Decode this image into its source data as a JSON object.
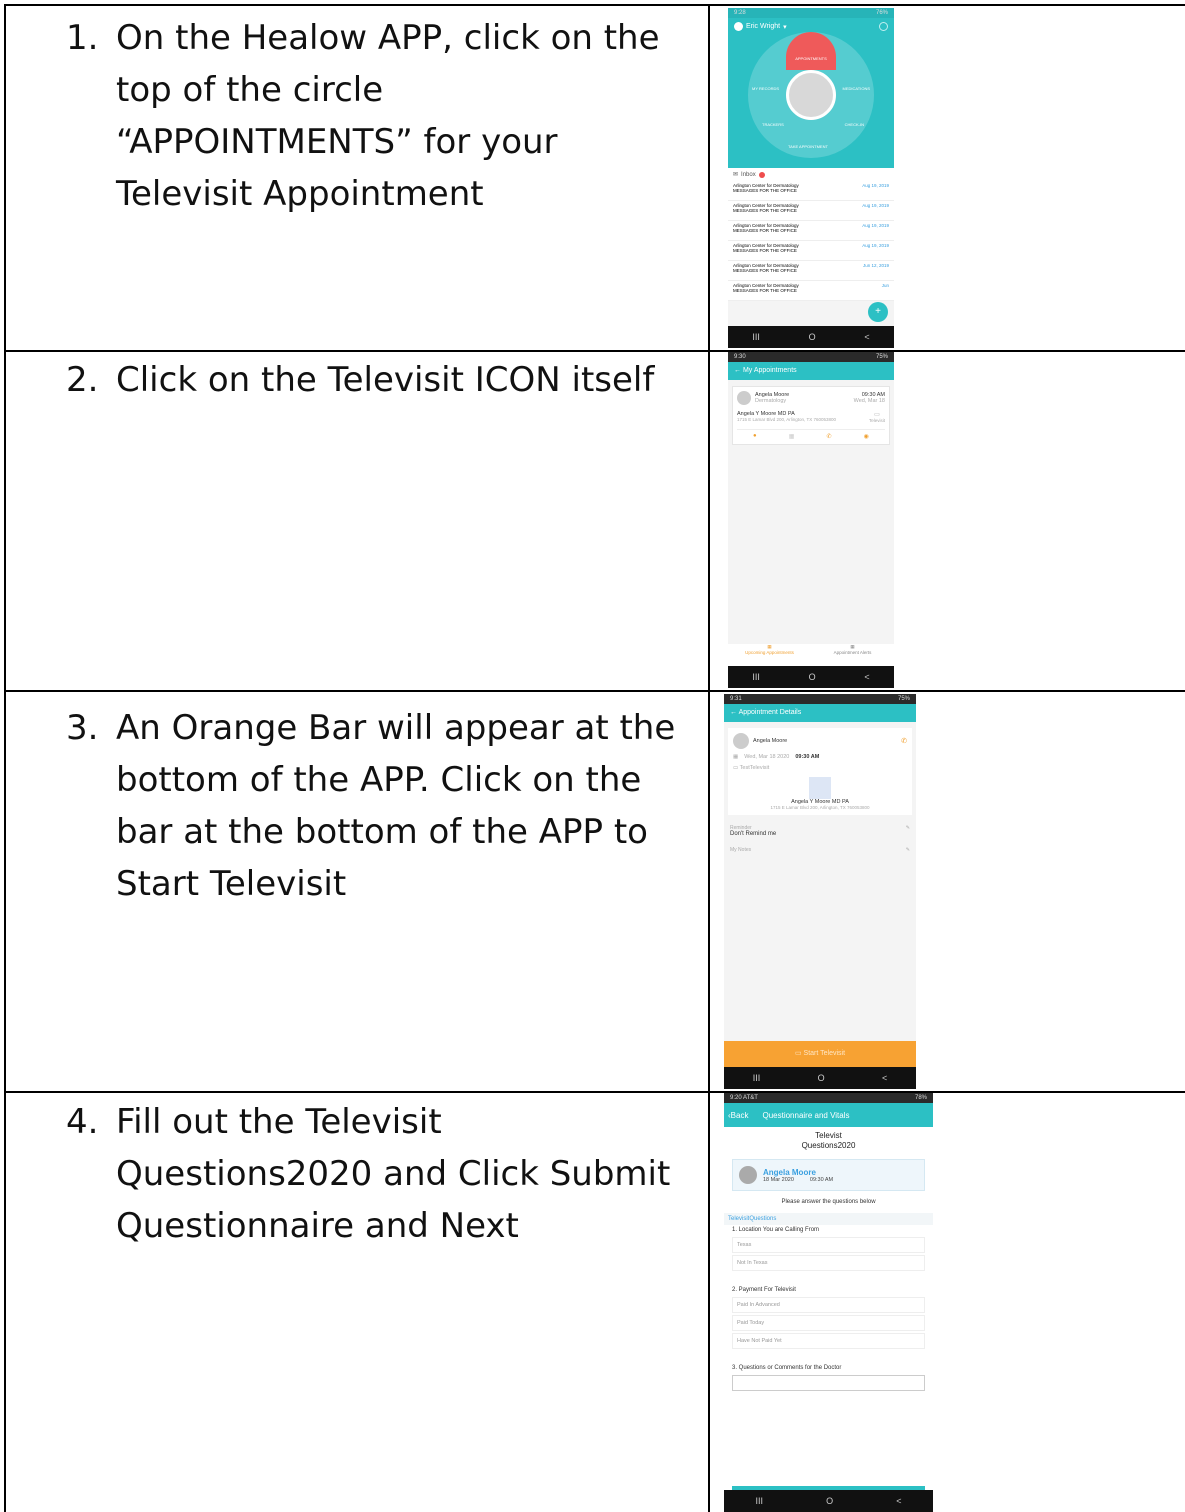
{
  "steps": [
    {
      "num": "1.",
      "text": "On the Healow APP, click on the\ntop of the circle\n“APPOINTMENTS” for your\nTelevisit Appointment"
    },
    {
      "num": "2.",
      "text": "Click on the Televisit ICON itself"
    },
    {
      "num": "3.",
      "text": "An Orange Bar will appear at the\nbottom of the APP. Click on the\nbar at the bottom of the APP to\nStart Televisit"
    },
    {
      "num": "4.",
      "text": "Fill out the Televisit\nQuestions2020 and Click Submit\nQuestionnaire and Next"
    }
  ],
  "screen1": {
    "status_time": "9:28",
    "status_right": "76%",
    "user": "Eric Wright",
    "wheel": {
      "top": "APPOINTMENTS",
      "left": "MY RECORDS",
      "right": "MEDICATIONS",
      "bottom_left": "TRACKERS",
      "bottom_right": "CHECK-IN",
      "bottom": "TAKE APPOINTMENT"
    },
    "inbox_label": "Inbox",
    "messages": [
      {
        "sender": "Arlington Center for Dermatology",
        "subject": "MESSAGES FOR THE OFFICE",
        "date": "Aug 19, 2019"
      },
      {
        "sender": "Arlington Center for Dermatology",
        "subject": "MESSAGES FOR THE OFFICE",
        "date": "Aug 19, 2019"
      },
      {
        "sender": "Arlington Center for Dermatology",
        "subject": "MESSAGES FOR THE OFFICE",
        "date": "Aug 19, 2019"
      },
      {
        "sender": "Arlington Center for Dermatology",
        "subject": "MESSAGES FOR THE OFFICE",
        "date": "Aug 19, 2019"
      },
      {
        "sender": "Arlington Center for Dermatology",
        "subject": "MESSAGES FOR THE OFFICE",
        "date": "Jun 12, 2019"
      },
      {
        "sender": "Arlington Center for Dermatology",
        "subject": "MESSAGES FOR THE OFFICE",
        "date": "Jun"
      }
    ],
    "fab": "+"
  },
  "screen2": {
    "status_time": "9:30",
    "status_right": "75%",
    "title": "My Appointments",
    "patient": "Angela Moore",
    "dept": "Dermatology",
    "time": "09:30 AM",
    "date": "Wed, Mar 18",
    "provider": "Angela Y Moore MD PA",
    "address": "1715 E Lamar Blvd 200, Arlington, TX 760053800",
    "visit_type": "Televisit",
    "tab_upcoming": "Upcoming Appointments",
    "tab_alerts": "Appointment Alerts"
  },
  "screen3": {
    "status_time": "9:31",
    "status_right": "75%",
    "title": "Appointment Details",
    "patient": "Angela Moore",
    "date": "Wed, Mar 18 2020",
    "time": "09:30 AM",
    "reason": "TestTelevisit",
    "provider": "Angela Y Moore MD PA",
    "address": "1715 E Lamar Blvd 200, Arlington, TX 760053800",
    "reminder_label": "Reminder",
    "reminder_value": "Don't Remind me",
    "notes_label": "My Notes",
    "start_button": "Start Televisit"
  },
  "screen4": {
    "status_time": "9:20 AT&T",
    "status_right": "78%",
    "back": "Back",
    "title": "Questionnaire and Vitals",
    "form_title": "Televist\nQuestions2020",
    "patient": "Angela Moore",
    "date": "18 Mar 2020",
    "time": "09:30 AM",
    "instruction": "Please answer the questions below",
    "section": "TelevisitQuestions",
    "q1": "1. Location You are Calling From",
    "q1_opts": [
      "Texas",
      "Not In Texas"
    ],
    "q2": "2. Payment For Televisit",
    "q2_opts": [
      "Paid In Advanced",
      "Paid Today",
      "Have Not Paid Yet"
    ],
    "q3": "3. Questions or Comments for the Doctor"
  },
  "nav": {
    "recent": "III",
    "home": "O",
    "back": "<"
  }
}
